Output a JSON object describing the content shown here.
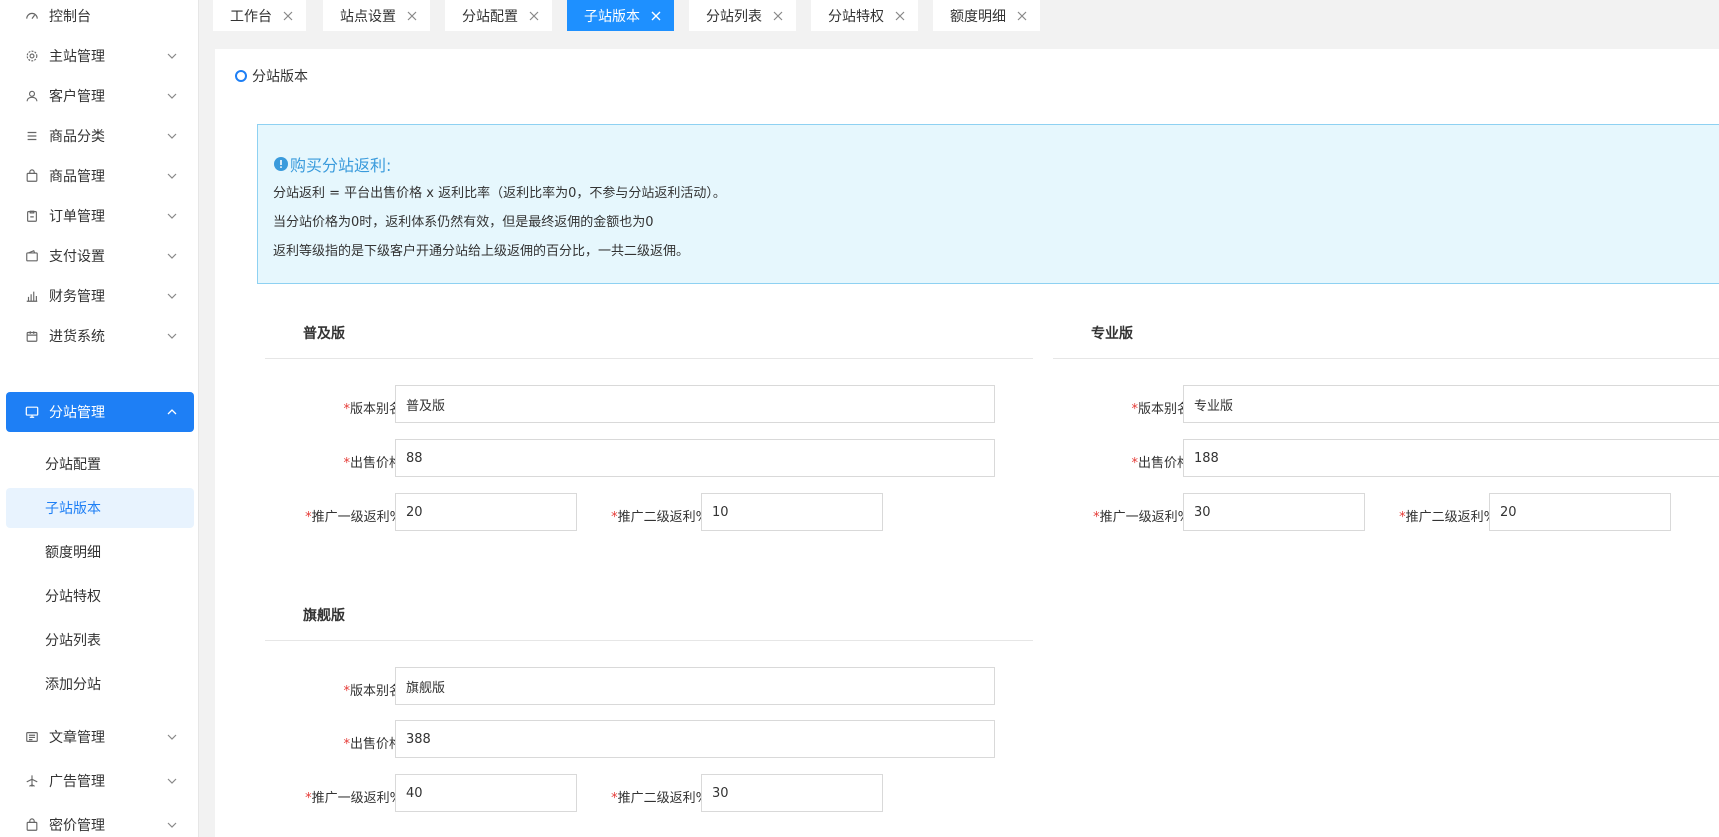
{
  "sidebar": {
    "items": [
      {
        "label": "控制台",
        "icon": "dashboard-icon"
      },
      {
        "label": "主站管理",
        "icon": "gear-icon"
      },
      {
        "label": "客户管理",
        "icon": "user-icon"
      },
      {
        "label": "商品分类",
        "icon": "list-icon"
      },
      {
        "label": "商品管理",
        "icon": "bag-icon"
      },
      {
        "label": "订单管理",
        "icon": "clipboard-icon"
      },
      {
        "label": "支付设置",
        "icon": "wallet-icon"
      },
      {
        "label": "财务管理",
        "icon": "bar-chart-icon"
      },
      {
        "label": "进货系统",
        "icon": "cart-icon"
      },
      {
        "label": "分站管理",
        "icon": "monitor-icon"
      },
      {
        "label": "文章管理",
        "icon": "document-icon"
      },
      {
        "label": "广告管理",
        "icon": "plane-icon"
      },
      {
        "label": "密价管理",
        "icon": "bag-icon"
      }
    ],
    "sub_items": [
      {
        "label": "分站配置"
      },
      {
        "label": "子站版本"
      },
      {
        "label": "额度明细"
      },
      {
        "label": "分站特权"
      },
      {
        "label": "分站列表"
      },
      {
        "label": "添加分站"
      }
    ]
  },
  "tabs": [
    {
      "label": "工作台"
    },
    {
      "label": "站点设置"
    },
    {
      "label": "分站配置"
    },
    {
      "label": "子站版本"
    },
    {
      "label": "分站列表"
    },
    {
      "label": "分站特权"
    },
    {
      "label": "额度明细"
    }
  ],
  "main": {
    "title": "分站版本",
    "notice": {
      "title": "购买分站返利:",
      "lines": [
        "分站返利 = 平台出售价格 x 返利比率（返利比率为0，不参与分站返利活动）。",
        "当分站价格为0时，返利体系仍然有效，但是最终返佣的金额也为0",
        "返利等级指的是下级客户开通分站给上级返佣的百分比，一共二级返佣。"
      ]
    },
    "labels": {
      "alias": "版本别名",
      "price": "出售价格",
      "level1": "推广一级返利%",
      "level2": "推广二级返利%",
      "required_mark": "*"
    },
    "versions": [
      {
        "title": "普及版",
        "alias": "普及版",
        "price": "88",
        "level1": "20",
        "level2": "10"
      },
      {
        "title": "专业版",
        "alias": "专业版",
        "price": "188",
        "level1": "30",
        "level2": "20"
      },
      {
        "title": "旗舰版",
        "alias": "旗舰版",
        "price": "388",
        "level1": "40",
        "level2": "30"
      }
    ]
  },
  "colors": {
    "primary": "#1e7ff5",
    "tab_active": "#1e90ff",
    "notice_bg": "#e6f7fd",
    "notice_border": "#8ed1f2",
    "required": "#e53935"
  }
}
